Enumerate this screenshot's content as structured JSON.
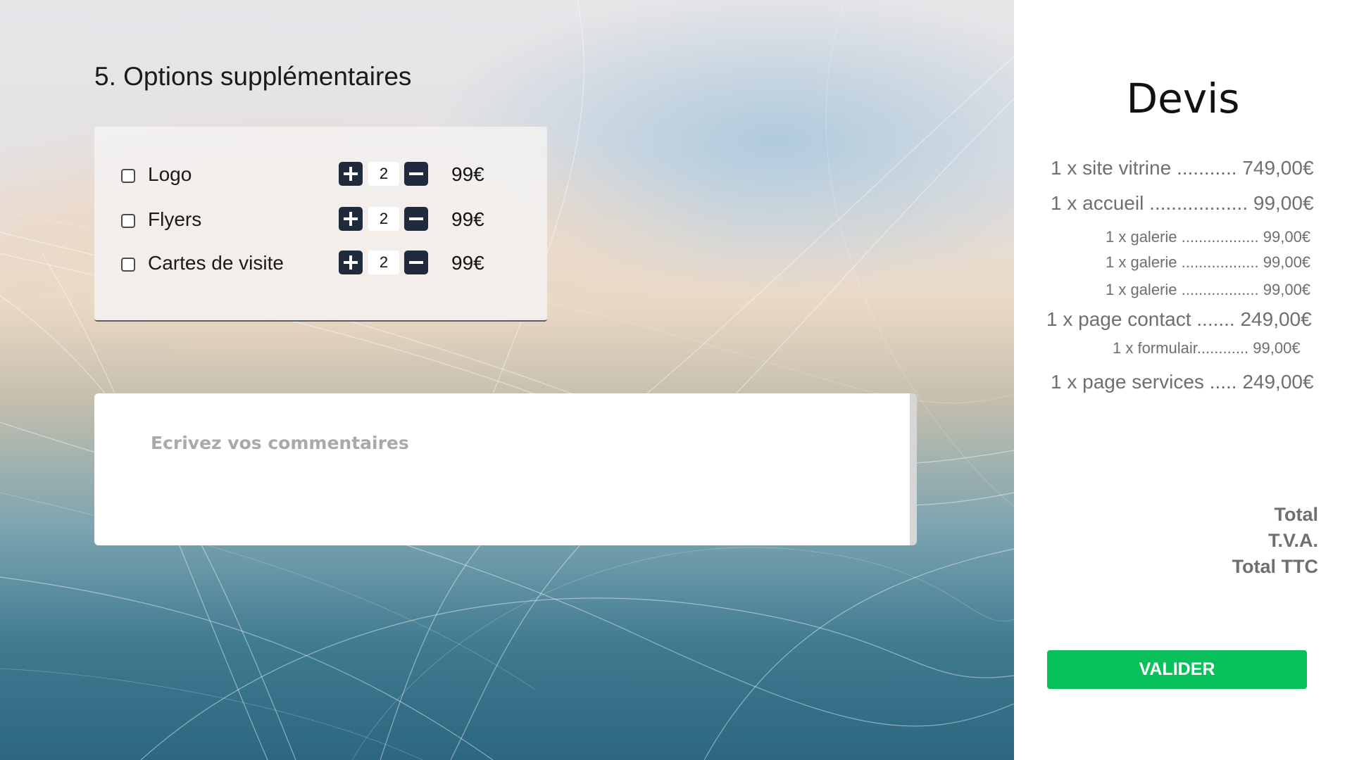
{
  "section": {
    "title": "5. Options supplémentaires"
  },
  "options": [
    {
      "label": "Logo",
      "quantity": "2",
      "price": "99€"
    },
    {
      "label": "Flyers",
      "quantity": "2",
      "price": "99€"
    },
    {
      "label": "Cartes de visite",
      "quantity": "2",
      "price": "99€"
    }
  ],
  "comments": {
    "placeholder": "Ecrivez vos commentaires"
  },
  "devis": {
    "title": "Devis",
    "lines": [
      "1 x site vitrine ........... 749,00€",
      "1 x accueil ..................  99,00€",
      "1 x galerie ..................  99,00€",
      "1 x galerie ..................  99,00€",
      "1 x galerie ..................  99,00€",
      "1 x page contact ....... 249,00€",
      "1 x formulair............  99,00€",
      "1 x page services ..... 249,00€"
    ],
    "totals": {
      "total": "Total",
      "tva": "T.V.A.",
      "total_ttc": "Total TTC"
    },
    "validate_label": "VALIDER"
  },
  "colors": {
    "stepper_button": "#1f2a3c",
    "validate_button": "#08c15b",
    "quote_text": "#6f6f6f"
  },
  "icons": {
    "increment": "plus-icon",
    "decrement": "minus-icon"
  }
}
